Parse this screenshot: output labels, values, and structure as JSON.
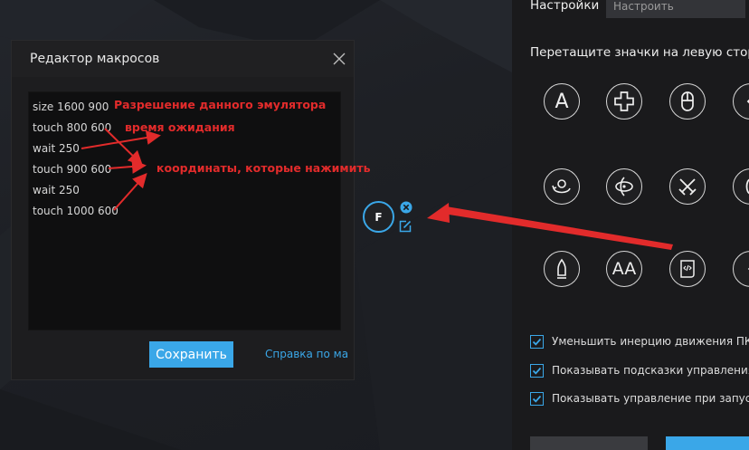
{
  "macro_editor": {
    "title": "Редактор макросов",
    "lines": [
      "size 1600 900",
      "touch 800 600",
      "wait 250",
      "touch 900 600",
      "wait 250",
      "touch 1000 600"
    ],
    "save_label": "Сохранить",
    "help_label": "Справка по ма"
  },
  "annotations": {
    "resolution": "Разрешение данного эмулятора",
    "wait_time": "время ожидания",
    "coordinates": "координаты, которые нажимить"
  },
  "f_widget": {
    "key_label": "F"
  },
  "settings": {
    "label": "Настройки",
    "select_placeholder": "Настроить",
    "drag_hint": "Перетащите значки на левую стор",
    "checkboxes": [
      {
        "label": "Уменьшить инерцию движения ПК",
        "checked": true
      },
      {
        "label": "Показывать подсказки управления",
        "checked": true
      },
      {
        "label": "Показывать управление при запус",
        "checked": true
      }
    ],
    "text_icon_label": "A",
    "aa_icon_label": "AA"
  },
  "colors": {
    "accent": "#3aa7e8",
    "annotation": "#e22b2b",
    "panel": "#1a1a1c"
  }
}
